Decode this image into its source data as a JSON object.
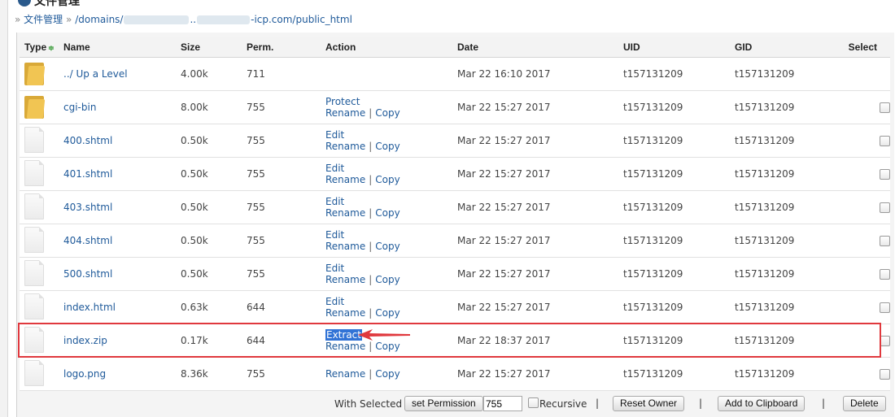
{
  "header": {
    "title": "文件管理",
    "breadcrumb": {
      "prefix": "»",
      "root": "文件管理",
      "sep": "»",
      "path_start": "/domains/",
      "path_mid": "..",
      "path_end": "-icp.com/public_html"
    }
  },
  "table": {
    "columns": {
      "type": "Type",
      "name": "Name",
      "size": "Size",
      "perm": "Perm.",
      "action": "Action",
      "date": "Date",
      "uid": "UID",
      "gid": "GID",
      "select": "Select"
    },
    "sort_indicator": "≑",
    "action_sep": "|",
    "rows": [
      {
        "icon": "folder",
        "name": "../ Up a Level",
        "size": "4.00k",
        "perm": "711",
        "action1": "",
        "action2": "",
        "action3": "",
        "date": "Mar 22 16:10 2017",
        "uid": "t157131209",
        "gid": "t157131209",
        "selectable": false
      },
      {
        "icon": "folder",
        "name": "cgi-bin",
        "size": "8.00k",
        "perm": "755",
        "action1": "Protect",
        "action2": "Rename",
        "action3": "Copy",
        "date": "Mar 22 15:27 2017",
        "uid": "t157131209",
        "gid": "t157131209",
        "selectable": true
      },
      {
        "icon": "file",
        "name": "400.shtml",
        "size": "0.50k",
        "perm": "755",
        "action1": "Edit",
        "action2": "Rename",
        "action3": "Copy",
        "date": "Mar 22 15:27 2017",
        "uid": "t157131209",
        "gid": "t157131209",
        "selectable": true
      },
      {
        "icon": "file",
        "name": "401.shtml",
        "size": "0.50k",
        "perm": "755",
        "action1": "Edit",
        "action2": "Rename",
        "action3": "Copy",
        "date": "Mar 22 15:27 2017",
        "uid": "t157131209",
        "gid": "t157131209",
        "selectable": true
      },
      {
        "icon": "file",
        "name": "403.shtml",
        "size": "0.50k",
        "perm": "755",
        "action1": "Edit",
        "action2": "Rename",
        "action3": "Copy",
        "date": "Mar 22 15:27 2017",
        "uid": "t157131209",
        "gid": "t157131209",
        "selectable": true
      },
      {
        "icon": "file",
        "name": "404.shtml",
        "size": "0.50k",
        "perm": "755",
        "action1": "Edit",
        "action2": "Rename",
        "action3": "Copy",
        "date": "Mar 22 15:27 2017",
        "uid": "t157131209",
        "gid": "t157131209",
        "selectable": true
      },
      {
        "icon": "file",
        "name": "500.shtml",
        "size": "0.50k",
        "perm": "755",
        "action1": "Edit",
        "action2": "Rename",
        "action3": "Copy",
        "date": "Mar 22 15:27 2017",
        "uid": "t157131209",
        "gid": "t157131209",
        "selectable": true
      },
      {
        "icon": "file",
        "name": "index.html",
        "size": "0.63k",
        "perm": "644",
        "action1": "Edit",
        "action2": "Rename",
        "action3": "Copy",
        "date": "Mar 22 15:27 2017",
        "uid": "t157131209",
        "gid": "t157131209",
        "selectable": true
      },
      {
        "icon": "file",
        "name": "index.zip",
        "size": "0.17k",
        "perm": "644",
        "action1": "Extract",
        "action2": "Rename",
        "action3": "Copy",
        "date": "Mar 22 18:37 2017",
        "uid": "t157131209",
        "gid": "t157131209",
        "selectable": true,
        "highlighted": true
      },
      {
        "icon": "file",
        "name": "logo.png",
        "size": "8.36k",
        "perm": "755",
        "action1": "",
        "action2": "Rename",
        "action3": "Copy",
        "date": "Mar 22 15:27 2017",
        "uid": "t157131209",
        "gid": "t157131209",
        "selectable": true
      }
    ]
  },
  "bottom_bar": {
    "with_selected": "With Selected",
    "set_permission": "set Permission",
    "perm_value": "755",
    "recursive": "Recursive",
    "reset_owner": "Reset Owner",
    "add_to_clipboard": "Add to Clipboard",
    "delete": "Delete",
    "sep": "|"
  },
  "colors": {
    "link": "#1f5a9a",
    "highlight_border": "#e0393e",
    "selection": "#3173d6",
    "folder": "#f1c553"
  }
}
